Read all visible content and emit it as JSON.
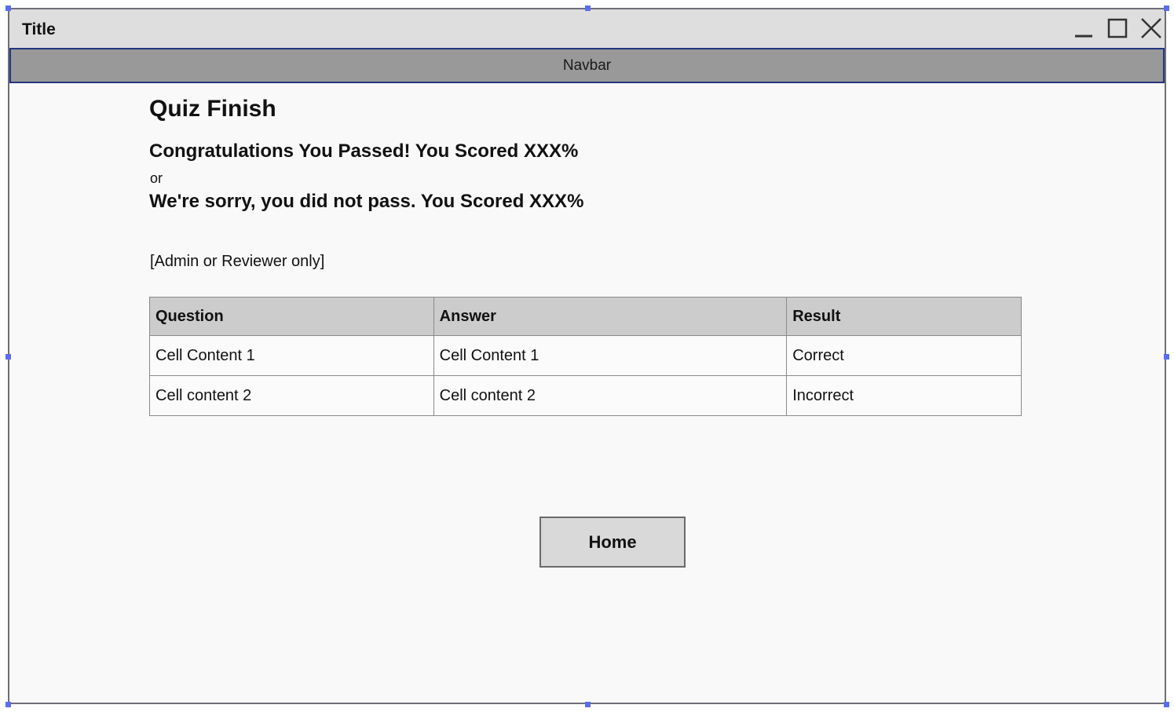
{
  "window": {
    "title": "Title",
    "navbar_label": "Navbar"
  },
  "page": {
    "title": "Quiz Finish",
    "pass_message": "Congratulations You Passed! You Scored XXX%",
    "or_text": "or",
    "fail_message": "We're sorry, you did not pass. You Scored XXX%",
    "admin_note": "[Admin or Reviewer only]"
  },
  "table": {
    "headers": [
      "Question",
      "Answer",
      "Result"
    ],
    "rows": [
      [
        "Cell Content 1",
        "Cell Content 1",
        "Correct"
      ],
      [
        "Cell content 2",
        "Cell content 2",
        "Incorrect"
      ]
    ]
  },
  "buttons": {
    "home_label": "Home"
  },
  "colors": {
    "selection_handle": "#5a6cf0",
    "navbar_border": "#24367f",
    "navbar_bg": "#999999",
    "titlebar_bg": "#dedede",
    "table_header_bg": "#cccccc"
  },
  "icons": {
    "minimize": "minimize-icon",
    "maximize": "maximize-icon",
    "close": "close-icon"
  }
}
